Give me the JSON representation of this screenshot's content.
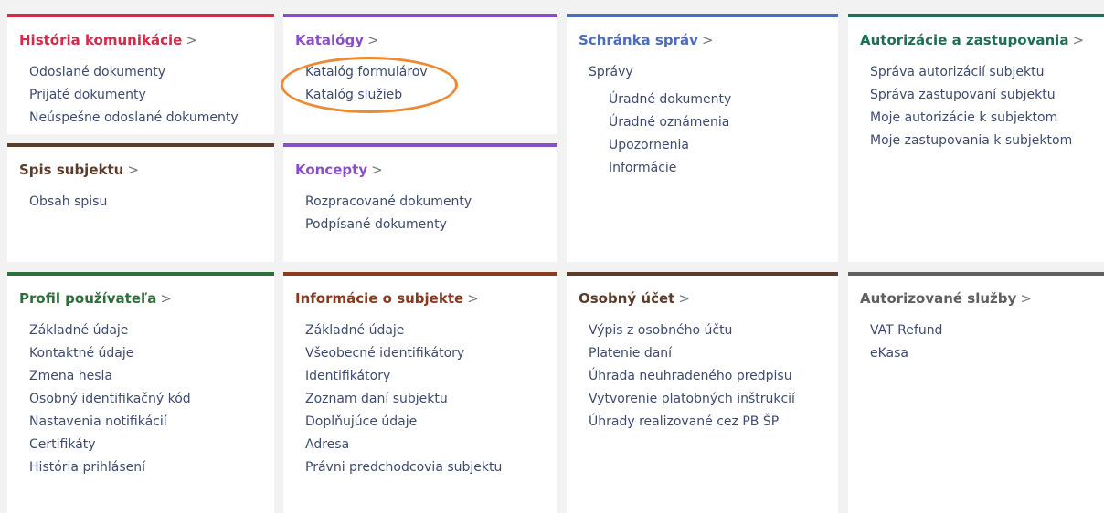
{
  "colors": {
    "red": "#d42a48",
    "purple": "#8a4fc7",
    "blue": "#4a6dbf",
    "teal": "#1f6e56",
    "brown": "#5c3d2b",
    "green": "#2e6e3a",
    "rust": "#8a3a1e",
    "gray": "#606060",
    "link": "#3e4b6f",
    "highlight": "#ee8a33"
  },
  "cards": {
    "historia": {
      "title": "História komunikácie",
      "arrow": ">",
      "items": [
        "Odoslané dokumenty",
        "Prijaté dokumenty",
        "Neúspešne odoslané dokumenty"
      ]
    },
    "katalogy": {
      "title": "Katalógy",
      "arrow": ">",
      "items": [
        "Katalóg formulárov",
        "Katalóg služieb"
      ]
    },
    "schranka": {
      "title": "Schránka správ",
      "arrow": ">",
      "items": [
        "Správy",
        "Úradné dokumenty",
        "Úradné oznámenia",
        "Upozornenia",
        "Informácie"
      ]
    },
    "autorizacie": {
      "title": "Autorizácie a zastupovania",
      "arrow": ">",
      "items": [
        "Správa autorizácií subjektu",
        "Správa zastupovaní subjektu",
        "Moje autorizácie k subjektom",
        "Moje zastupovania k subjektom"
      ]
    },
    "spis": {
      "title": "Spis subjektu",
      "arrow": ">",
      "items": [
        "Obsah spisu"
      ]
    },
    "koncepty": {
      "title": "Koncepty",
      "arrow": ">",
      "items": [
        "Rozpracované dokumenty",
        "Podpísané dokumenty"
      ]
    },
    "profil": {
      "title": "Profil používateľa",
      "arrow": ">",
      "items": [
        "Základné údaje",
        "Kontaktné údaje",
        "Zmena hesla",
        "Osobný identifikačný kód",
        "Nastavenia notifikácií",
        "Certifikáty",
        "História prihlásení"
      ]
    },
    "informacie": {
      "title": "Informácie o subjekte",
      "arrow": ">",
      "items": [
        "Základné údaje",
        "Všeobecné identifikátory",
        "Identifikátory",
        "Zoznam daní subjektu",
        "Doplňujúce údaje",
        "Adresa",
        "Právni predchodcovia subjektu"
      ]
    },
    "ucet": {
      "title": "Osobný účet",
      "arrow": ">",
      "items": [
        "Výpis z osobného účtu",
        "Platenie daní",
        "Úhrada neuhradeného predpisu",
        "Vytvorenie platobných inštrukcií",
        "Úhrady realizované cez PB ŠP"
      ]
    },
    "sluzby": {
      "title": "Autorizované služby",
      "arrow": ">",
      "items": [
        "VAT Refund",
        "eKasa"
      ]
    }
  }
}
